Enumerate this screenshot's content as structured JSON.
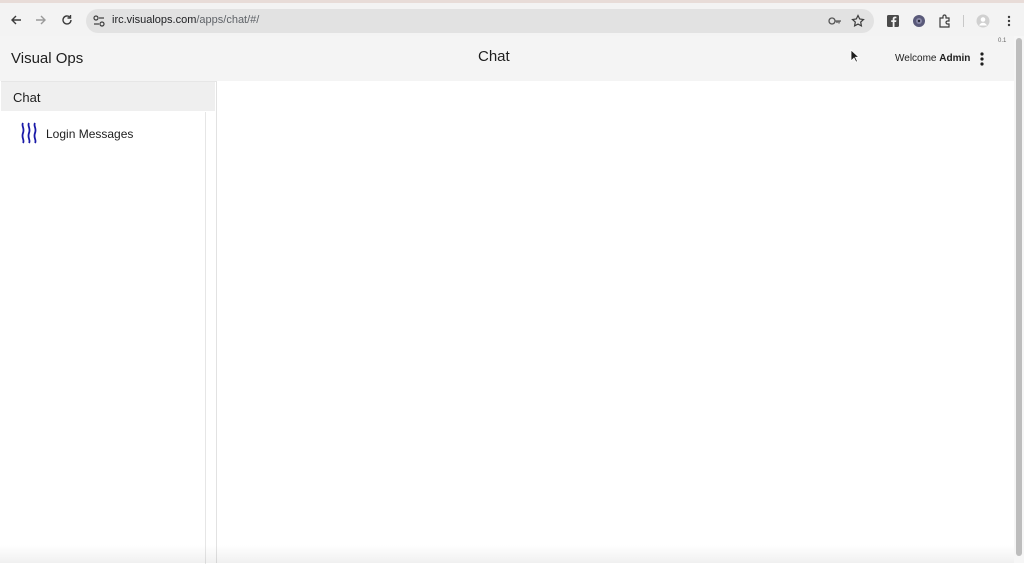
{
  "browser": {
    "url_host": "irc.visualops.com",
    "url_path": "/apps/chat/#/"
  },
  "app": {
    "brand": "Visual Ops",
    "title": "Chat",
    "welcome_prefix": "Welcome",
    "user": "Admin",
    "version": "0.1"
  },
  "sidebar": {
    "header": "Chat",
    "items": [
      {
        "label": "Login Messages",
        "icon": "waves-icon",
        "icon_color": "#1a1aa8"
      }
    ]
  },
  "colors": {
    "header_bg": "#f4f4f4",
    "sidebar_header_bg": "#efefef",
    "omnibox_bg": "#e2e2e2"
  }
}
